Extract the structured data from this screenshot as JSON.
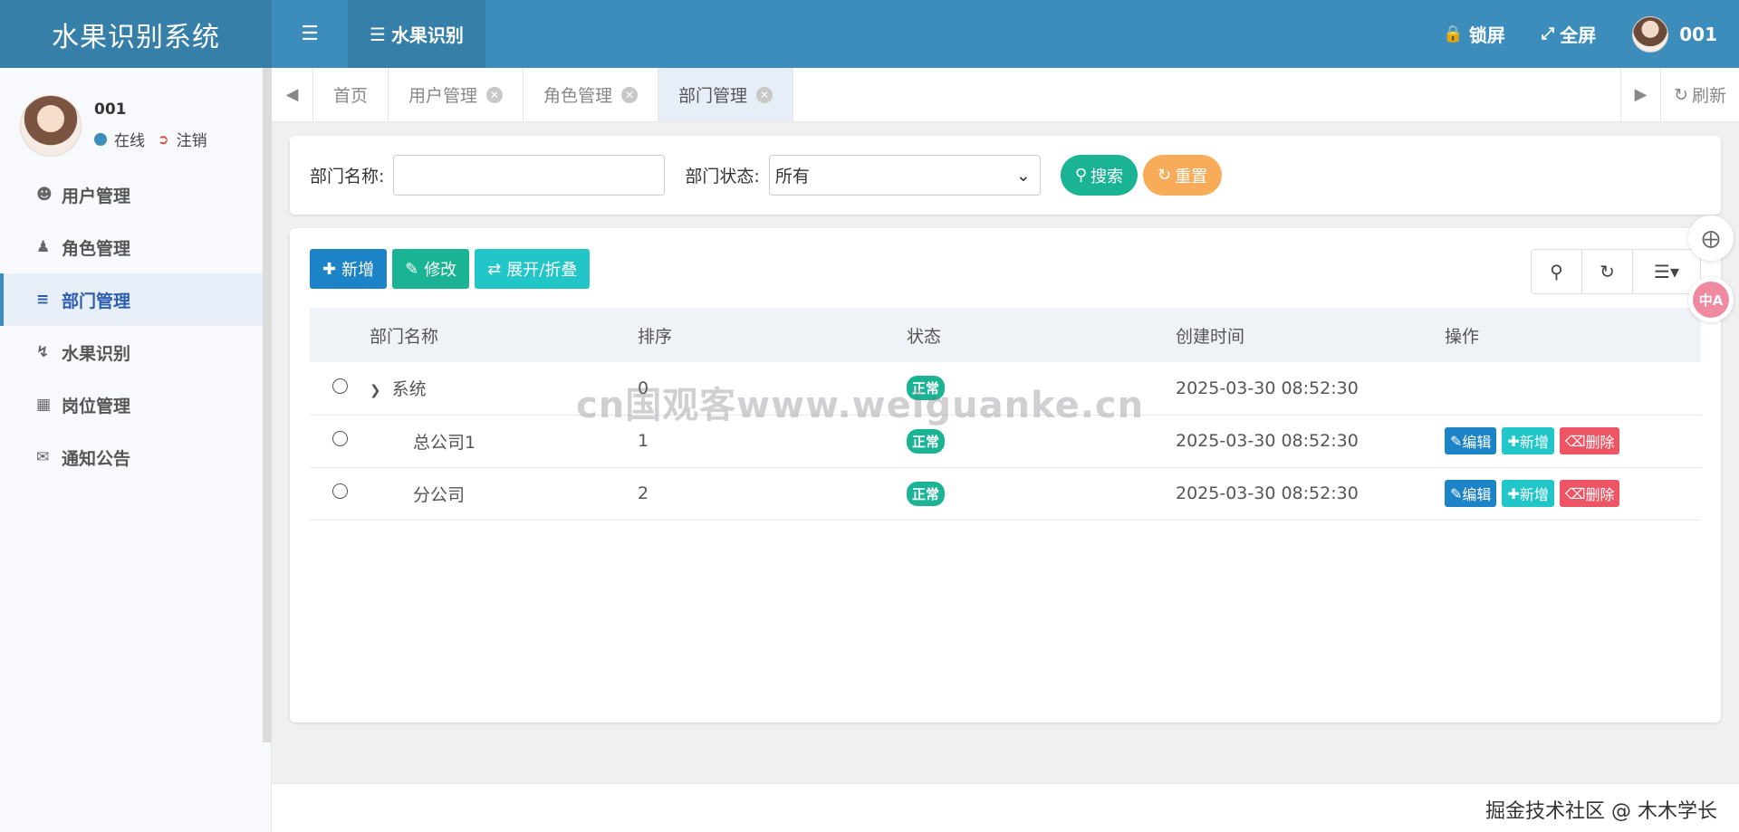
{
  "header": {
    "brand": "水果识别系统",
    "menu_icon": "hamburger-icon",
    "module_label": "水果识别",
    "lock_label": "锁屏",
    "fullscreen_label": "全屏",
    "user_name": "001"
  },
  "sidebar": {
    "profile": {
      "name": "001",
      "status": "在线",
      "logout": "注销"
    },
    "items": [
      {
        "label": "用户管理",
        "icon": "user-icon"
      },
      {
        "label": "角色管理",
        "icon": "role-icon"
      },
      {
        "label": "部门管理",
        "icon": "outdent-icon",
        "active": true
      },
      {
        "label": "水果识别",
        "icon": "bolt-icon"
      },
      {
        "label": "岗位管理",
        "icon": "id-card-icon"
      },
      {
        "label": "通知公告",
        "icon": "bullhorn-icon"
      }
    ]
  },
  "tabs": {
    "items": [
      {
        "label": "首页"
      },
      {
        "label": "用户管理"
      },
      {
        "label": "角色管理"
      },
      {
        "label": "部门管理",
        "active": true
      }
    ],
    "refresh_label": "刷新"
  },
  "search": {
    "dept_name_label": "部门名称:",
    "dept_name_value": "",
    "dept_status_label": "部门状态:",
    "dept_status_value": "所有",
    "search_btn": "搜索",
    "reset_btn": "重置"
  },
  "toolbar": {
    "add_label": "新增",
    "edit_label": "修改",
    "expand_label": "展开/折叠"
  },
  "table": {
    "columns": [
      "部门名称",
      "排序",
      "状态",
      "创建时间",
      "操作"
    ],
    "rows": [
      {
        "name": "系统",
        "order": "0",
        "status": "正常",
        "created": "2025-03-30 08:52:30",
        "has_ops": false
      },
      {
        "name": "总公司1",
        "order": "1",
        "status": "正常",
        "created": "2025-03-30 08:52:30",
        "has_ops": true
      },
      {
        "name": "分公司",
        "order": "2",
        "status": "正常",
        "created": "2025-03-30 08:52:30",
        "has_ops": true
      }
    ],
    "ops": {
      "edit": "编辑",
      "add": "新增",
      "delete": "删除"
    }
  },
  "watermark": "cn国观客www.weiguanke.cn",
  "footer": "掘金技术社区 @ 木木学长",
  "colors": {
    "primary": "#3c8dbc",
    "green": "#1ab394",
    "orange": "#f8ac59",
    "blue": "#1c84c6",
    "cyan": "#23c6c8",
    "red": "#ed5565"
  }
}
